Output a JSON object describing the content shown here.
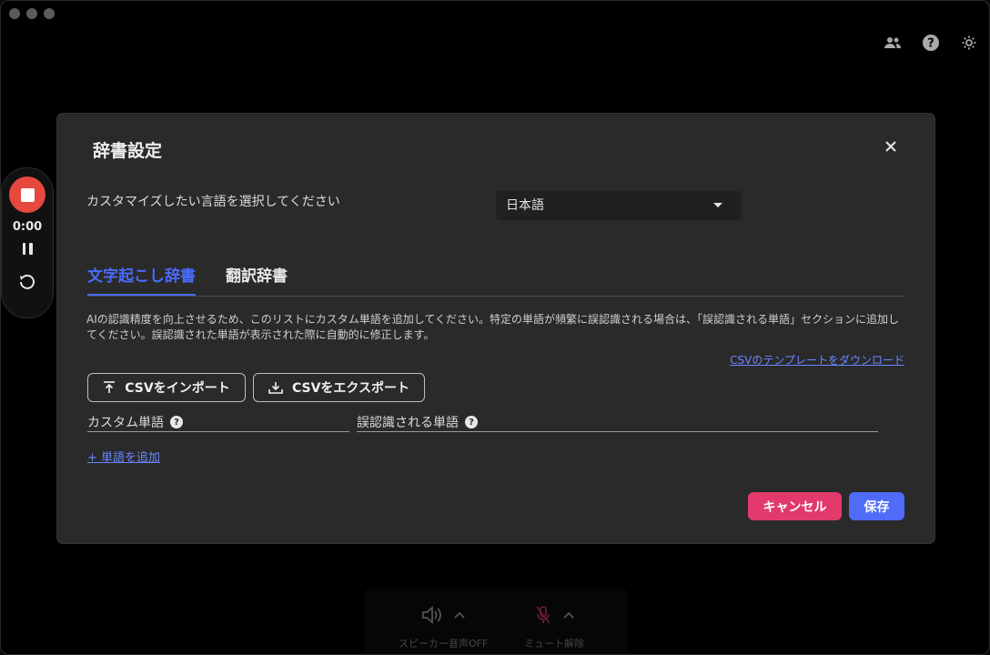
{
  "window": {
    "top_icons": [
      "people-icon",
      "help-icon",
      "settings-icon"
    ]
  },
  "recorder": {
    "timer": "0:00",
    "accent": "#e5483c"
  },
  "modal": {
    "title": "辞書設定",
    "language_label": "カスタマイズしたい言語を選択してください",
    "language_value": "日本語",
    "tabs": [
      {
        "label": "文字起こし辞書",
        "active": true
      },
      {
        "label": "翻訳辞書",
        "active": false
      }
    ],
    "description": "AIの認識精度を向上させるため、このリストにカスタム単語を追加してください。特定の単語が頻繁に誤認識される場合は、「誤認識される単語」セクションに追加してください。誤認識された単語が表示された際に自動的に修正します。",
    "template_link": "CSVのテンプレートをダウンロード",
    "import_button": "CSVをインポート",
    "export_button": "CSVをエクスポート",
    "field_custom_word": "カスタム単語",
    "field_misrecognized_word": "誤認識される単語",
    "add_word_link": "+ 単語を追加",
    "cancel_button": "キャンセル",
    "save_button": "保存",
    "colors": {
      "accent": "#4a6bff",
      "cancel": "#e23a6d",
      "save": "#4e6cf7"
    }
  },
  "bottom_bar": {
    "speaker_label": "スピーカー音声OFF",
    "mic_label": "ミュート解除"
  }
}
